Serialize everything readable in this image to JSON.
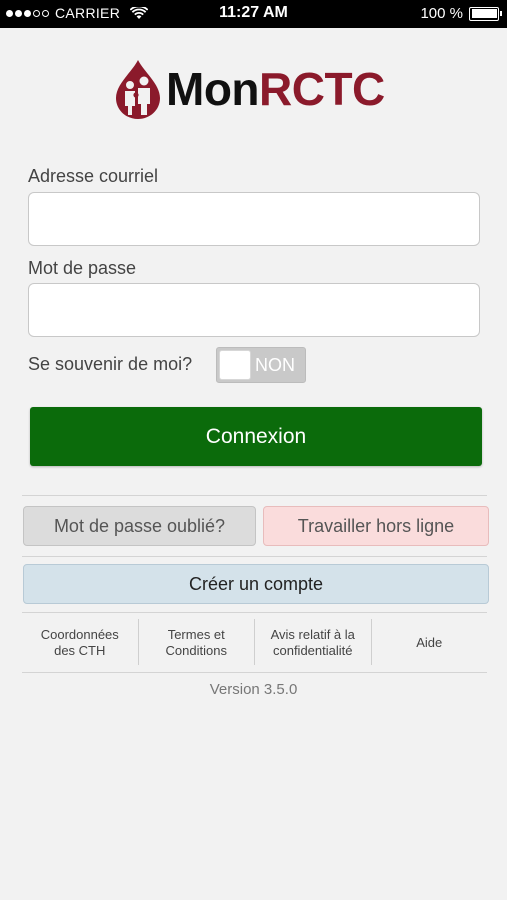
{
  "status_bar": {
    "carrier": "CARRIER",
    "time": "11:27 AM",
    "battery_text": "100 %",
    "battery_level": 1.0,
    "signal_bars_filled": 3,
    "signal_bars_total": 5
  },
  "logo": {
    "text_mon": "Mon",
    "text_rctc": "RCTC",
    "brand_color": "#8b1a2b"
  },
  "form": {
    "email_label": "Adresse courriel",
    "email_value": "",
    "password_label": "Mot de passe",
    "password_value": "",
    "remember_label": "Se souvenir de moi?",
    "remember_state": "NON",
    "login_button": "Connexion",
    "login_color": "#0b6b0b"
  },
  "actions": {
    "forgot_password": "Mot de passe oublié?",
    "work_offline": "Travailler hors ligne",
    "create_account": "Créer un compte"
  },
  "footer": {
    "links": [
      {
        "line1": "Coordonnées",
        "line2": "des CTH"
      },
      {
        "line1": "Termes et",
        "line2": "Conditions"
      },
      {
        "line1": "Avis relatif à la",
        "line2": "confidentialité"
      },
      {
        "line1": "Aide",
        "line2": ""
      }
    ],
    "version": "Version 3.5.0"
  }
}
